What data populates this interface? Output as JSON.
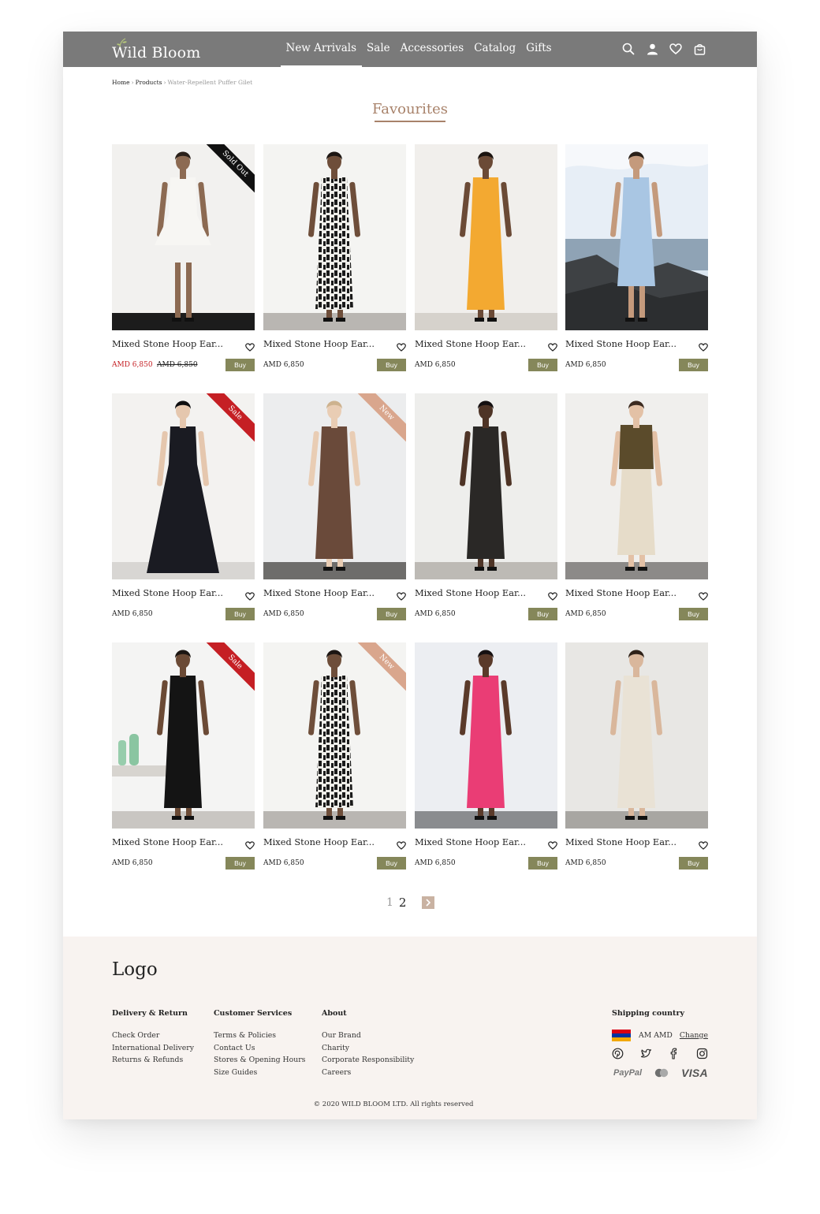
{
  "brand": {
    "name": "Wild Bloom"
  },
  "nav": {
    "items": [
      {
        "label": "New Arrivals",
        "active": true
      },
      {
        "label": "Sale"
      },
      {
        "label": "Accessories"
      },
      {
        "label": "Catalog"
      },
      {
        "label": "Gifts"
      }
    ]
  },
  "header_icons": [
    "search-icon",
    "user-icon",
    "heart-icon",
    "bag-icon"
  ],
  "breadcrumb": {
    "items": [
      "Home",
      "Products"
    ],
    "current": "Water-Repellent Puffer Gilet"
  },
  "page_title": "Favourites",
  "products": [
    {
      "name": "Mixed Stone Hoop Ear...",
      "price": "AMD 6,850",
      "old_price": "AMD 6,850",
      "badge": "Sold Out",
      "badge_type": "sold",
      "buy": "Buy"
    },
    {
      "name": "Mixed Stone Hoop Ear...",
      "price": "AMD 6,850",
      "badge": "",
      "buy": "Buy"
    },
    {
      "name": "Mixed Stone Hoop Ear...",
      "price": "AMD 6,850",
      "badge": "",
      "buy": "Buy"
    },
    {
      "name": "Mixed Stone Hoop Ear...",
      "price": "AMD 6,850",
      "badge": "",
      "buy": "Buy"
    },
    {
      "name": "Mixed Stone Hoop Ear...",
      "price": "AMD 6,850",
      "badge": "Sale",
      "badge_type": "sale",
      "buy": "Buy"
    },
    {
      "name": "Mixed Stone Hoop Ear...",
      "price": "AMD 6,850",
      "badge": "New",
      "badge_type": "new",
      "buy": "Buy"
    },
    {
      "name": "Mixed Stone Hoop Ear...",
      "price": "AMD 6,850",
      "badge": "",
      "buy": "Buy"
    },
    {
      "name": "Mixed Stone Hoop Ear...",
      "price": "AMD 6,850",
      "badge": "",
      "buy": "Buy"
    },
    {
      "name": "Mixed Stone Hoop Ear...",
      "price": "AMD 6,850",
      "badge": "Sale",
      "badge_type": "sale",
      "buy": "Buy"
    },
    {
      "name": "Mixed Stone Hoop Ear...",
      "price": "AMD 6,850",
      "badge": "New",
      "badge_type": "new",
      "buy": "Buy"
    },
    {
      "name": "Mixed Stone Hoop Ear...",
      "price": "AMD 6,850",
      "badge": "",
      "buy": "Buy"
    },
    {
      "name": "Mixed Stone Hoop Ear...",
      "price": "AMD 6,850",
      "badge": "",
      "buy": "Buy"
    }
  ],
  "pagination": {
    "pages": [
      "1",
      "2"
    ],
    "current": "2",
    "next_icon": "chevron-right-icon"
  },
  "footer": {
    "logo": "Logo",
    "columns": [
      {
        "title": "Delivery & Return",
        "links": [
          "Check Order",
          "International Delivery",
          "Returns & Refunds"
        ]
      },
      {
        "title": "Customer Services",
        "links": [
          "Terms & Policies",
          "Contact Us",
          "Stores & Opening Hours",
          "Size Guides"
        ]
      },
      {
        "title": "About",
        "links": [
          "Our Brand",
          "Charity",
          "Corporate Responsibility",
          "Careers"
        ]
      }
    ],
    "shipping": {
      "title": "Shipping country",
      "currency": "AM AMD",
      "change": "Change"
    },
    "socials": [
      "pinterest-icon",
      "twitter-icon",
      "facebook-icon",
      "instagram-icon"
    ],
    "payments": {
      "paypal": "PayPal",
      "visa": "VISA"
    },
    "copyright": "© 2020 WILD BLOOM LTD. All rights reserved"
  },
  "colors": {
    "header_bg": "#7a7a7a",
    "accent": "#a8826a",
    "buy_button": "#85875a",
    "sale_red": "#c51f24",
    "new_badge": "#d9a68d",
    "footer_bg": "#f8f3f0"
  }
}
